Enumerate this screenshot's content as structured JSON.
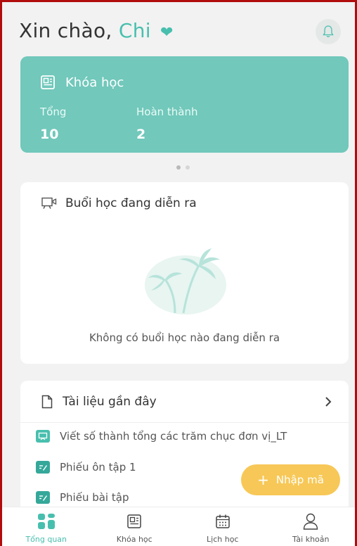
{
  "header": {
    "greeting": "Xin chào,",
    "name": "Chi",
    "heart_icon": "heart-icon",
    "bell_icon": "bell-icon"
  },
  "course_summary": {
    "title": "Khóa học",
    "total_label": "Tổng",
    "total_value": "10",
    "completed_label": "Hoàn thành",
    "completed_value": "2",
    "color": "#71c8bb"
  },
  "carousel": {
    "pages": 2,
    "active_index": 0
  },
  "live_session": {
    "title": "Buổi học đang diễn ra",
    "empty_text": "Không có buổi học nào đang diễn ra",
    "icon": "presentation-icon"
  },
  "recent_docs": {
    "title": "Tài liệu gần đây",
    "items": [
      {
        "label": "Viết số thành tổng các trăm chục đơn vị_LT",
        "icon": "presentation-icon",
        "color": "#48bfae"
      },
      {
        "label": "Phiếu ôn tập 1",
        "icon": "worksheet-icon",
        "color": "#35a89a"
      },
      {
        "label": "Phiếu bài tập",
        "icon": "worksheet-icon",
        "color": "#35a89a"
      }
    ]
  },
  "fab": {
    "label": "Nhập mã",
    "icon": "plus-icon",
    "color": "#f7c857"
  },
  "bottom_nav": {
    "items": [
      {
        "label": "Tổng quan",
        "icon": "dashboard-icon",
        "active": true
      },
      {
        "label": "Khóa học",
        "icon": "book-icon",
        "active": false
      },
      {
        "label": "Lịch học",
        "icon": "calendar-icon",
        "active": false
      },
      {
        "label": "Tài khoản",
        "icon": "user-icon",
        "active": false
      }
    ]
  },
  "colors": {
    "accent": "#48bfae",
    "frame_border": "#b10d0d"
  }
}
